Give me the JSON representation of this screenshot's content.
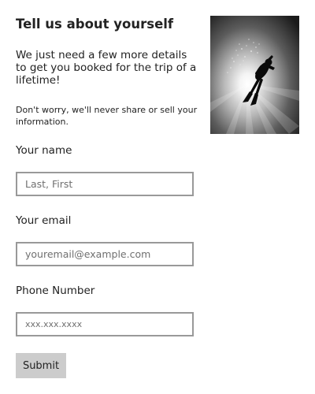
{
  "header": {
    "title": "Tell us about yourself",
    "intro": "We just need a few more details to get you booked for the trip of a lifetime!",
    "privacy_note": "Don't worry, we'll never share or sell your information."
  },
  "image": {
    "subject": "scuba-diver-photo"
  },
  "form": {
    "name": {
      "label": "Your name",
      "placeholder": "Last, First",
      "value": ""
    },
    "email": {
      "label": "Your email",
      "placeholder": "youremail@example.com",
      "value": ""
    },
    "phone": {
      "label": "Phone Number",
      "placeholder": "xxx.xxx.xxxx",
      "value": ""
    },
    "submit_label": "Submit"
  },
  "colors": {
    "input_border": "#999999",
    "button_background": "#cccccc",
    "text": "#222222"
  }
}
